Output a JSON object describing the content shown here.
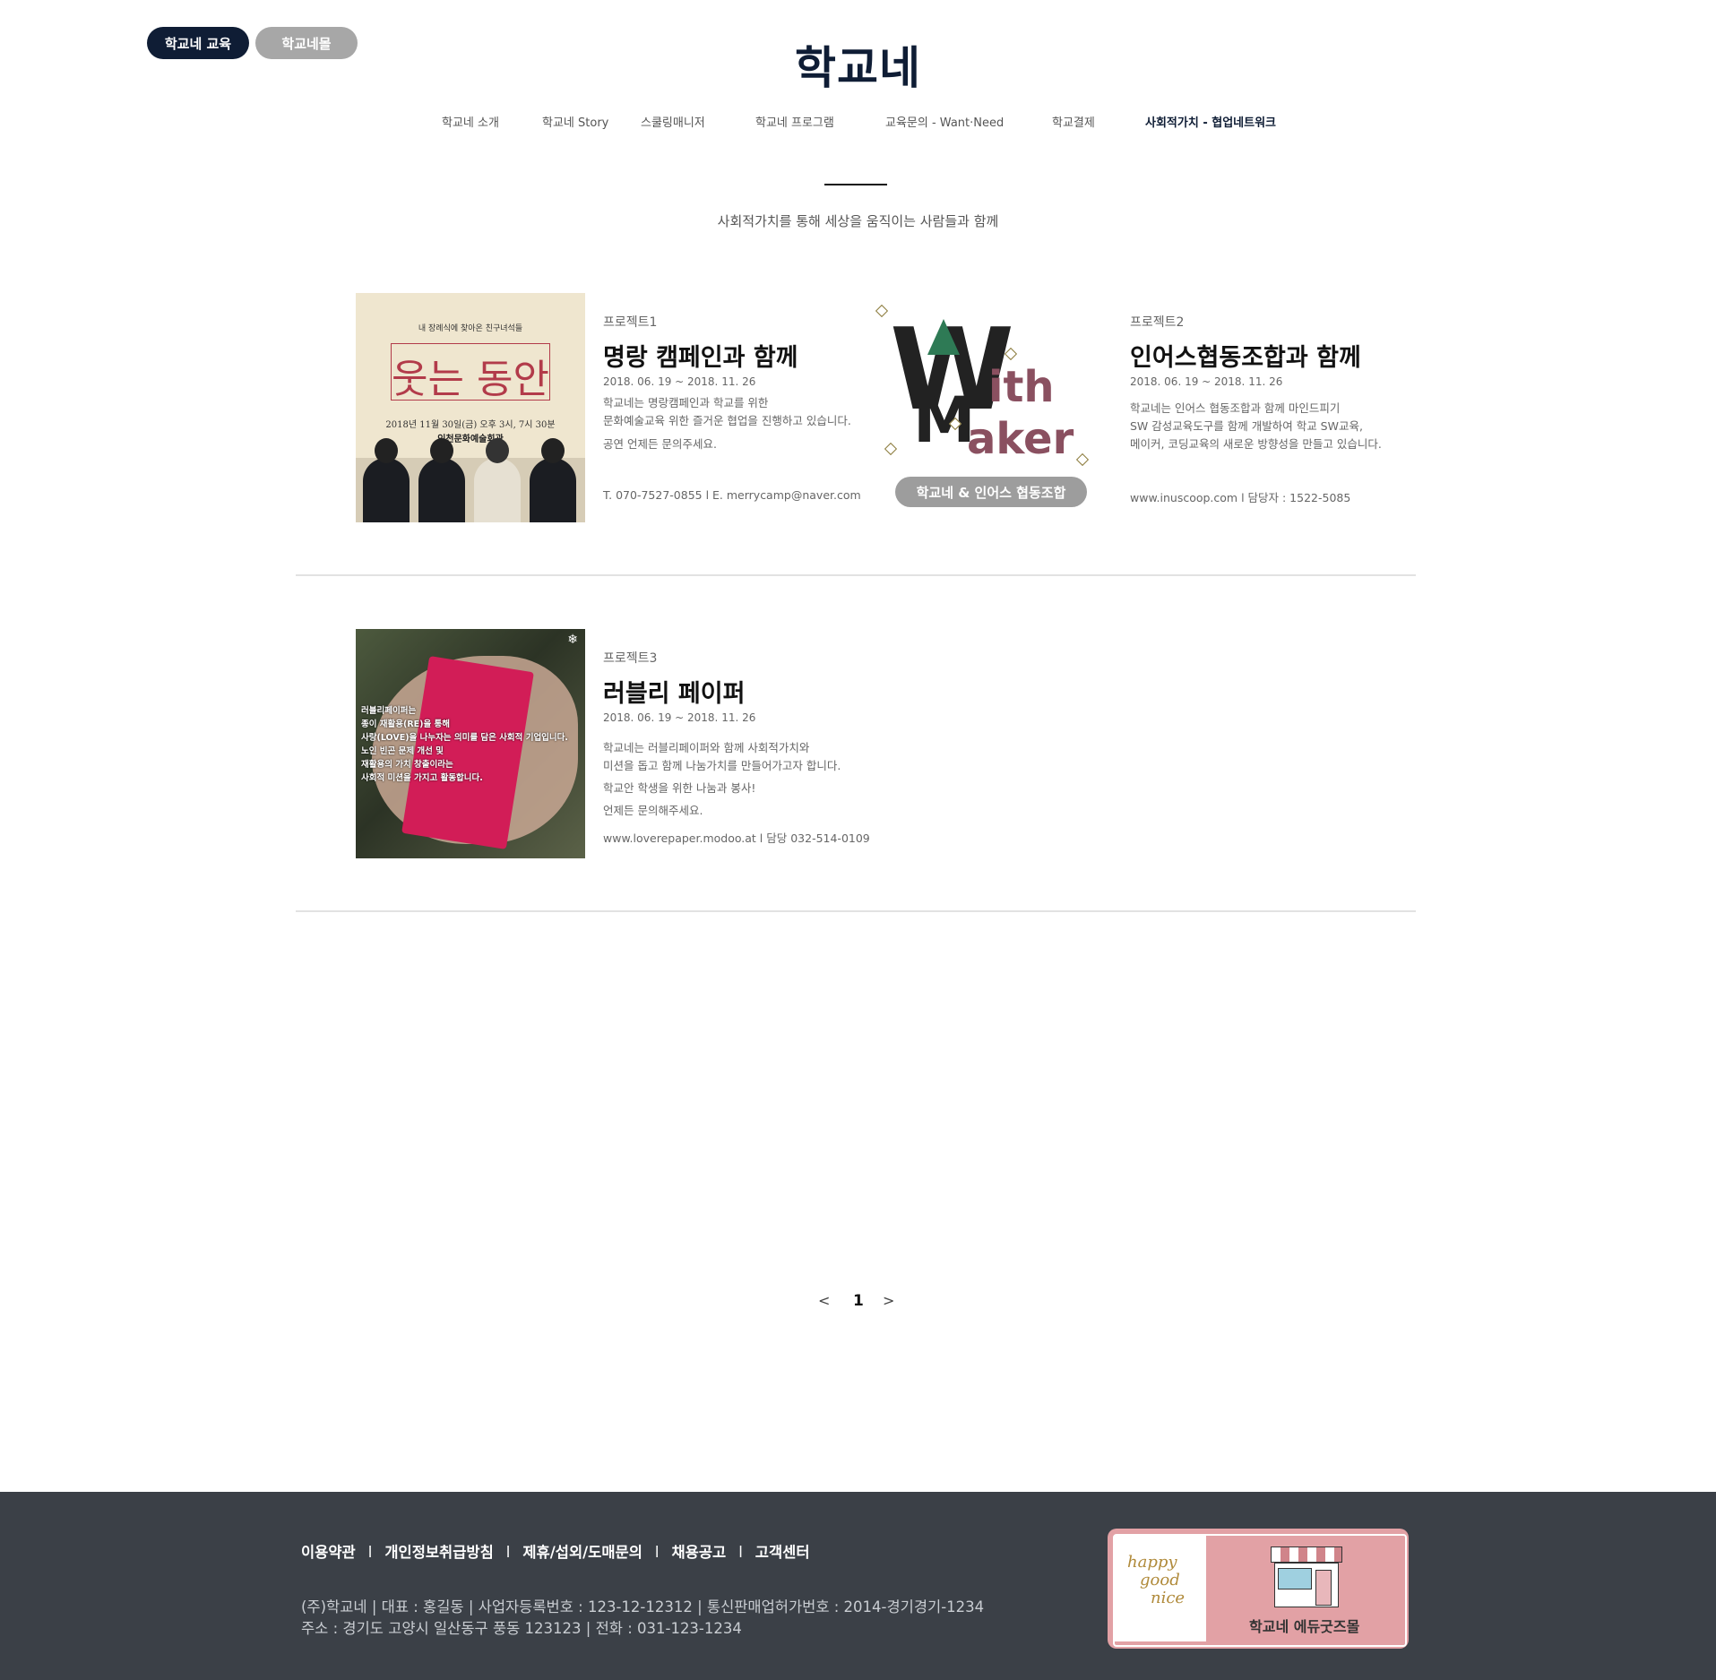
{
  "header": {
    "pill_edu": "학교네 교육",
    "pill_mall": "학교네몰",
    "logo": "학교네"
  },
  "nav": [
    {
      "label": "학교네 소개"
    },
    {
      "label": "학교네 Story"
    },
    {
      "label": "스쿨링매니저"
    },
    {
      "label": "학교네 프로그램"
    },
    {
      "label": "교육문의 - Want·Need"
    },
    {
      "label": "학교결제"
    },
    {
      "label": "사회적가치 - 협업네트워크",
      "active": true
    }
  ],
  "tagline": "사회적가치를 통해 세상을 움직이는 사람들과 함께",
  "projects": [
    {
      "label": "프로젝트1",
      "title": "명랑 캠페인과 함께",
      "date": "2018. 06. 19 ~ 2018. 11. 26",
      "lines": [
        "학교네는 명랑캠페인과 학교를 위한",
        "문화예술교육 위한 즐거운 협업을 진행하고 있습니다.",
        "공연 언제든 문의주세요."
      ],
      "contact": "T. 070-7527-0855  l E. merrycamp@naver.com",
      "poster": {
        "small": "내 장례식에 찾아온 친구녀석들",
        "big": "웃는 동안",
        "when": "2018년 11월 30일(금) 오후 3시, 7시 30분",
        "where": "인천문화예술회관"
      }
    },
    {
      "label": "프로젝트2",
      "title": "인어스협동조합과 함께",
      "date": "2018. 06. 19 ~ 2018. 11. 26",
      "lines": [
        "학교네는 인어스 협동조합과 함께 마인드피기",
        "SW 감성교육도구를 함께 개발하여  학교 SW교육,",
        "메이커, 코딩교육의 새로운 방향성을 만들고 있습니다."
      ],
      "contact": "www.inuscoop.com  l  담당자 : 1522-5085",
      "badge": {
        "w": "W",
        "ith": "ith",
        "m": "M",
        "aker": "aker",
        "caption": "학교네 & 인어스 협동조합"
      }
    },
    {
      "label": "프로젝트3",
      "title": "러블리 페이퍼",
      "date": "2018. 06. 19 ~ 2018. 11. 26",
      "lines": [
        "학교네는 러블리페이퍼와 함께 사회적가치와",
        "미션을 돕고 함께 나눔가치를 만들어가고자 합니다.",
        "학교안 학생을 위한 나눔과 봉사!",
        "언제든 문의해주세요."
      ],
      "contact": "www.loverepaper.modoo.at  l  담당 032-514-0109",
      "poster": {
        "overlay": [
          "러블리페이퍼는",
          "종이 재활용(RE)을 통해",
          "사랑(LOVE)을 나누자는 의미를 담은 사회적 기업입니다.",
          "노인 빈곤 문제 개선 및",
          "재활용의 가치 창출이라는",
          "사회적 미션을 가지고 활동합니다."
        ]
      }
    }
  ],
  "pagination": {
    "prev": "<",
    "current": "1",
    "next": ">"
  },
  "footer": {
    "links": [
      "이용약관",
      "개인정보취급방침",
      "제휴/섭외/도매문의",
      "채용공고",
      "고객센터"
    ],
    "separator": "l",
    "info_line1": "(주)학교네   |   대표 : 홍길동   |   사업자등록번호 : 123-12-12312   |   통신판매업허가번호 : 2014-경기경기-1234",
    "info_line2": "주소 : 경기도 고양시 일산동구 풍동 123123   |   전화 : 031-123-1234",
    "banner_logo": [
      "happy",
      "good",
      "nice"
    ],
    "banner_text": "학교네 에듀굿즈몰"
  },
  "colors": {
    "navy": "#0f1d35",
    "grey_pill": "#a7a7a7",
    "footer_bg": "#3b4047",
    "banner_pink": "#e2a1a5"
  }
}
